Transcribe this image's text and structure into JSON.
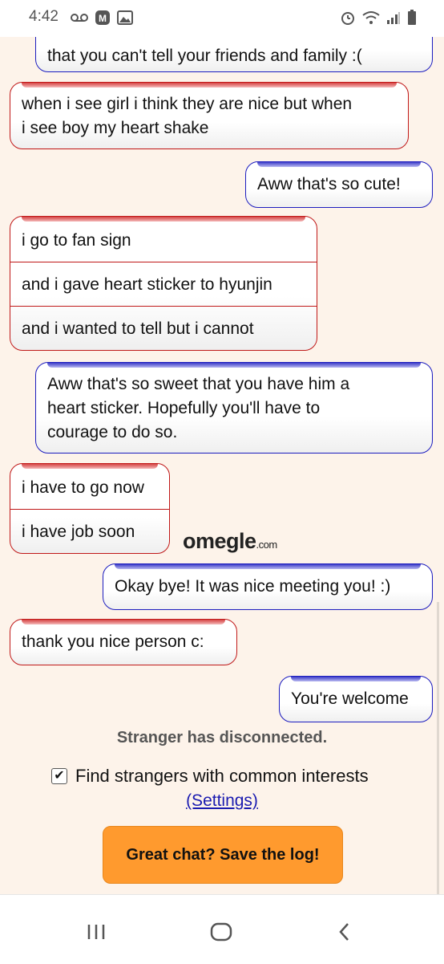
{
  "status_bar": {
    "time": "4:42",
    "left_icons": [
      "voicemail-icon",
      "app-notification-icon",
      "image-icon"
    ],
    "right_icons": [
      "alarm-icon",
      "wifi-icon",
      "signal-icon",
      "battery-icon"
    ]
  },
  "messages": [
    {
      "from": "you",
      "lines": [
        "that you can't tell your friends and family :("
      ]
    },
    {
      "from": "stranger",
      "lines": [
        "when i see girl i think they are nice but when",
        "i see boy my heart shake"
      ]
    },
    {
      "from": "you",
      "lines": [
        "Aww that's so cute!"
      ]
    },
    {
      "from": "stranger",
      "segments": [
        "i go to fan sign",
        "and i gave heart sticker to hyunjin",
        "and i wanted to tell but i cannot"
      ]
    },
    {
      "from": "you",
      "lines": [
        "Aww that's so sweet that you have him a",
        "heart sticker. Hopefully you'll have to",
        "courage to do so."
      ]
    },
    {
      "from": "stranger",
      "segments": [
        "i have to go now",
        "i have job soon"
      ]
    },
    {
      "from": "you",
      "lines": [
        "Okay bye! It was nice meeting you! :)"
      ]
    },
    {
      "from": "stranger",
      "lines": [
        "thank you nice person c:"
      ]
    },
    {
      "from": "you",
      "lines": [
        "You're welcome"
      ]
    }
  ],
  "logo": {
    "name": "omegle",
    "suffix": ".com"
  },
  "disconnected_text": "Stranger has disconnected.",
  "interests": {
    "label": "Find strangers with common interests",
    "checked": true,
    "check_mark": "✔"
  },
  "settings_link": "(Settings)",
  "save_button": "Great chat? Save the log!",
  "nav": [
    "recent-apps-icon",
    "home-icon",
    "back-icon"
  ],
  "colors": {
    "stranger": "#c01818",
    "you": "#1c1cbf",
    "save_button": "#ff9a2e",
    "background": "#fdf3ea"
  }
}
